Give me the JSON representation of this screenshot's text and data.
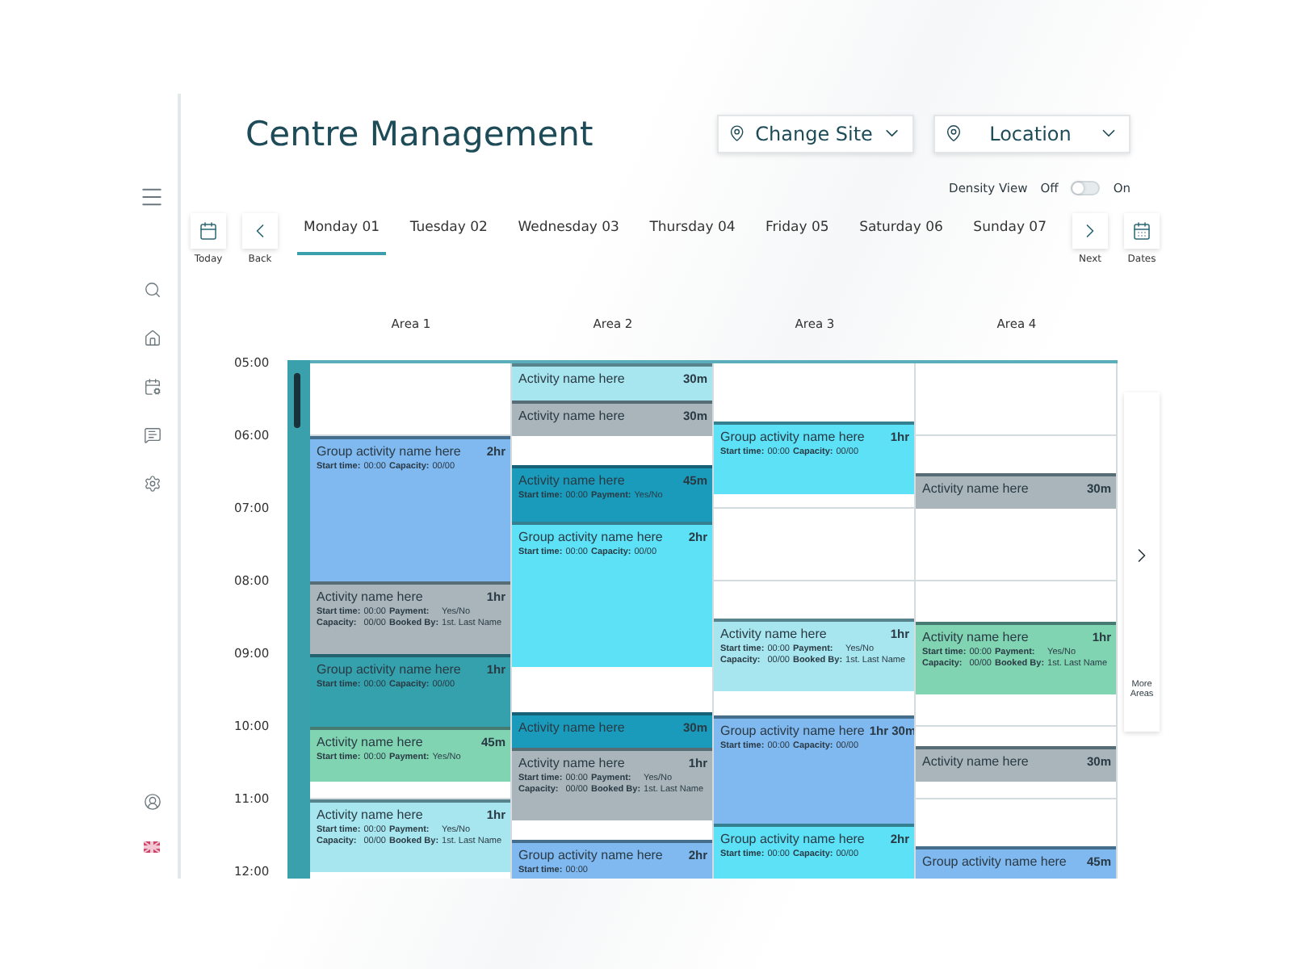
{
  "header": {
    "title": "Centre Management",
    "dropdowns": [
      {
        "label": "Change Site"
      },
      {
        "label": "Location"
      }
    ]
  },
  "density_view": {
    "label": "Density View",
    "off_label": "Off",
    "on_label": "On",
    "on": false
  },
  "nav": {
    "today": "Today",
    "back": "Back",
    "next": "Next",
    "dates": "Dates"
  },
  "days": [
    {
      "label": "Monday 01",
      "selected": true
    },
    {
      "label": "Tuesday 02",
      "selected": false
    },
    {
      "label": "Wednesday 03",
      "selected": false
    },
    {
      "label": "Thursday 04",
      "selected": false
    },
    {
      "label": "Friday 05",
      "selected": false
    },
    {
      "label": "Saturday 06",
      "selected": false
    },
    {
      "label": "Sunday 07",
      "selected": false
    }
  ],
  "hours": [
    "05:00",
    "06:00",
    "07:00",
    "08:00",
    "09:00",
    "10:00",
    "11:00",
    "12:00"
  ],
  "areas": [
    {
      "name": "Area 1",
      "events": [
        {
          "title": "Group activity name here",
          "duration": "2hr",
          "color": "#80b8f0",
          "details": [
            {
              "label": "Start time:",
              "value": "00:00"
            },
            {
              "label": "Capacity:",
              "value": "00/00"
            }
          ]
        },
        {
          "title": "Activity name here",
          "duration": "1hr",
          "color": "#a9b5ba",
          "details": [
            {
              "label": "Start time:",
              "value": "00:00"
            },
            {
              "label": "Payment:",
              "value": "Yes/No"
            },
            {
              "label": "Capacity:",
              "value": "00/00"
            },
            {
              "label": "Booked By:",
              "value": "1st. Last Name"
            }
          ]
        },
        {
          "title": "Group activity name here",
          "duration": "1hr",
          "color": "#35a1ad",
          "details": [
            {
              "label": "Start time:",
              "value": "00:00"
            },
            {
              "label": "Capacity:",
              "value": "00/00"
            }
          ]
        },
        {
          "title": "Activity name here",
          "duration": "45m",
          "color": "#80d4b2",
          "details": [
            {
              "label": "Start time:",
              "value": "00:00"
            },
            {
              "label": "Payment:",
              "value": "Yes/No"
            }
          ]
        },
        {
          "title": "Activity name here",
          "duration": "1hr",
          "color": "#a8e6ef",
          "details": [
            {
              "label": "Start time:",
              "value": "00:00"
            },
            {
              "label": "Payment:",
              "value": "Yes/No"
            },
            {
              "label": "Capacity:",
              "value": "00/00"
            },
            {
              "label": "Booked By:",
              "value": "1st. Last Name"
            }
          ]
        }
      ]
    },
    {
      "name": "Area 2",
      "events": [
        {
          "title": "Activity name here",
          "duration": "30m",
          "color": "#a8e6ef"
        },
        {
          "title": "Activity name here",
          "duration": "30m",
          "color": "#a9b5ba"
        },
        {
          "title": "Activity name here",
          "duration": "45m",
          "color": "#1a9bbb",
          "details": [
            {
              "label": "Start time:",
              "value": "00:00"
            },
            {
              "label": "Payment:",
              "value": "Yes/No"
            }
          ]
        },
        {
          "title": "Group activity name here",
          "duration": "2hr",
          "color": "#5ce1f7",
          "details": [
            {
              "label": "Start time:",
              "value": "00:00"
            },
            {
              "label": "Capacity:",
              "value": "00/00"
            }
          ]
        },
        {
          "title": "Activity name here",
          "duration": "30m",
          "color": "#1a9bbb"
        },
        {
          "title": "Activity name here",
          "duration": "1hr",
          "color": "#a9b5ba",
          "details": [
            {
              "label": "Start time:",
              "value": "00:00"
            },
            {
              "label": "Payment:",
              "value": "Yes/No"
            },
            {
              "label": "Capacity:",
              "value": "00/00"
            },
            {
              "label": "Booked By:",
              "value": "1st. Last Name"
            }
          ]
        },
        {
          "title": "Group activity name here",
          "duration": "2hr",
          "color": "#80b8f0",
          "details": [
            {
              "label": "Start time:",
              "value": "00:00"
            }
          ]
        }
      ]
    },
    {
      "name": "Area 3",
      "events": [
        {
          "title": "Group activity name here",
          "duration": "1hr",
          "color": "#5ce1f7",
          "details": [
            {
              "label": "Start time:",
              "value": "00:00"
            },
            {
              "label": "Capacity:",
              "value": "00/00"
            }
          ]
        },
        {
          "title": "Activity name here",
          "duration": "1hr",
          "color": "#a8e6ef",
          "details": [
            {
              "label": "Start time:",
              "value": "00:00"
            },
            {
              "label": "Payment:",
              "value": "Yes/No"
            },
            {
              "label": "Capacity:",
              "value": "00/00"
            },
            {
              "label": "Booked By:",
              "value": "1st. Last Name"
            }
          ]
        },
        {
          "title": "Group activity name here",
          "duration": "1hr 30m",
          "color": "#80b8f0",
          "details": [
            {
              "label": "Start time:",
              "value": "00:00"
            },
            {
              "label": "Capacity:",
              "value": "00/00"
            }
          ]
        },
        {
          "title": "Group activity name here",
          "duration": "2hr",
          "color": "#5ce1f7",
          "details": [
            {
              "label": "Start time:",
              "value": "00:00"
            },
            {
              "label": "Capacity:",
              "value": "00/00"
            }
          ]
        }
      ]
    },
    {
      "name": "Area 4",
      "events": [
        {
          "title": "Activity name here",
          "duration": "30m",
          "color": "#a9b5ba"
        },
        {
          "title": "Activity name here",
          "duration": "1hr",
          "color": "#80d4b2",
          "details": [
            {
              "label": "Start time:",
              "value": "00:00"
            },
            {
              "label": "Payment:",
              "value": "Yes/No"
            },
            {
              "label": "Capacity:",
              "value": "00/00"
            },
            {
              "label": "Booked By:",
              "value": "1st. Last Name"
            }
          ]
        },
        {
          "title": "Activity name here",
          "duration": "30m",
          "color": "#a9b5ba"
        },
        {
          "title": "Group activity name here",
          "duration": "45m",
          "color": "#80b8f0"
        }
      ]
    }
  ],
  "more_areas": {
    "label": "More Areas"
  }
}
